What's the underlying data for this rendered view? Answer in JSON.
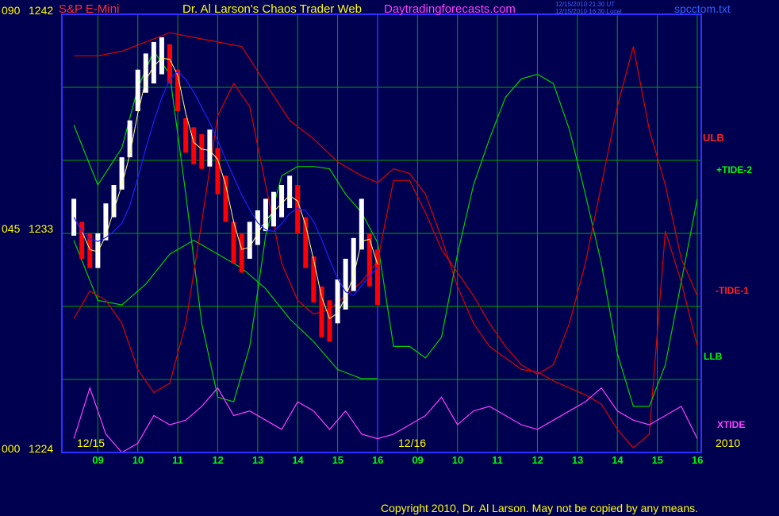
{
  "header": {
    "instrument": "S&P E-Mini",
    "title": "Dr. Al Larson's Chaos Trader Web",
    "site": "Daytradingforecasts.com",
    "stamp_ut": "12/15/2010 21:30 UT",
    "stamp_local": "12/15/2010 16:30 Local",
    "filename": "spcctom.txt"
  },
  "y_axis": {
    "top": {
      "pct": "090",
      "price": "1242"
    },
    "mid": {
      "pct": "045",
      "price": "1233"
    },
    "bottom": {
      "pct": "000",
      "price": "1224"
    }
  },
  "dates": {
    "day1": "12/15",
    "day2": "12/16",
    "year": "2010"
  },
  "hours": [
    "09",
    "10",
    "11",
    "12",
    "13",
    "14",
    "15",
    "16",
    "09",
    "10",
    "11",
    "12",
    "13",
    "14",
    "15",
    "16"
  ],
  "legend": {
    "ulb": "ULB",
    "tide2": "+TIDE-2",
    "tide1": "-TIDE-1",
    "llb": "LLB",
    "xtide": "XTIDE"
  },
  "copyright": "Copyright 2010, Dr. Al Larson. May not be copied by any means.",
  "colors": {
    "background": "#000050",
    "grid": "#00a000",
    "frame": "#3030ff",
    "price_up": "#ffffff",
    "price_down": "#ff0000",
    "ma_fast": "#ffff80",
    "ma_slow": "#2020ff",
    "tide_red": "#e00000",
    "tide_green": "#00d000",
    "xtide": "#ff40ff",
    "label_yellow": "#ffff00",
    "label_green": "#00ff00",
    "label_red": "#ff3030"
  },
  "chart_data": {
    "type": "line",
    "xlabel": "",
    "ylabel": "",
    "ylim": [
      1224,
      1243
    ],
    "x_ticks": [
      "09",
      "10",
      "11",
      "12",
      "13",
      "14",
      "15",
      "16",
      "09",
      "10",
      "11",
      "12",
      "13",
      "14",
      "15",
      "16"
    ],
    "y_ticks": [
      1224,
      1233,
      1242
    ],
    "grid": true,
    "price_bars": {
      "hours": [
        8.4,
        8.6,
        8.8,
        9.0,
        9.2,
        9.4,
        9.6,
        9.8,
        10.0,
        10.2,
        10.4,
        10.6,
        10.8,
        11.0,
        11.2,
        11.4,
        11.6,
        11.8,
        12.0,
        12.2,
        12.4,
        12.6,
        12.8,
        13.0,
        13.2,
        13.4,
        13.6,
        13.8,
        14.0,
        14.2,
        14.4,
        14.6,
        14.8,
        15.0,
        15.2,
        15.4,
        15.6,
        15.8,
        16.0
      ],
      "close": [
        1234.2,
        1233.0,
        1232.6,
        1232.8,
        1234.0,
        1235.0,
        1236.2,
        1237.6,
        1239.8,
        1240.5,
        1241.0,
        1241.2,
        1240.9,
        1239.8,
        1237.6,
        1237.3,
        1237.0,
        1237.2,
        1236.2,
        1235.0,
        1233.0,
        1232.6,
        1233.2,
        1233.8,
        1234.3,
        1234.6,
        1235.0,
        1235.3,
        1234.5,
        1233.2,
        1231.5,
        1230.0,
        1229.6,
        1230.5,
        1231.0,
        1232.3,
        1234.0,
        1232.5,
        1231.8
      ],
      "high": [
        1235.0,
        1234.0,
        1233.5,
        1233.5,
        1234.8,
        1235.6,
        1236.8,
        1238.4,
        1240.6,
        1241.3,
        1241.8,
        1242.0,
        1241.7,
        1240.6,
        1238.5,
        1238.1,
        1237.8,
        1238.0,
        1237.2,
        1236.0,
        1234.0,
        1233.5,
        1234.0,
        1234.5,
        1235.0,
        1235.3,
        1235.6,
        1236.0,
        1235.6,
        1234.2,
        1232.5,
        1231.2,
        1230.6,
        1231.5,
        1232.4,
        1233.3,
        1235.0,
        1233.5,
        1232.8
      ],
      "low": [
        1233.4,
        1232.4,
        1232.0,
        1232.0,
        1233.2,
        1234.2,
        1235.4,
        1236.8,
        1238.8,
        1239.6,
        1240.0,
        1240.4,
        1240.0,
        1238.8,
        1237.0,
        1236.5,
        1236.3,
        1236.4,
        1235.2,
        1234.0,
        1232.2,
        1231.8,
        1232.4,
        1233.0,
        1233.6,
        1233.8,
        1234.2,
        1234.6,
        1233.5,
        1232.0,
        1230.5,
        1229.0,
        1228.8,
        1229.6,
        1230.2,
        1231.0,
        1232.8,
        1231.2,
        1230.4
      ]
    },
    "series": [
      {
        "name": "ULB",
        "x": [
          8.4,
          9.0,
          9.6,
          10.2,
          10.8,
          11.4,
          12.0,
          12.6,
          13.2,
          13.8,
          14.4,
          15.0,
          15.6,
          16.0,
          16.4,
          16.8,
          17.2,
          17.6,
          18.0,
          18.4,
          18.8,
          19.2,
          19.6,
          20.0,
          20.4,
          20.8,
          21.2,
          21.6,
          22.0,
          22.4,
          22.8,
          23.2,
          23.6,
          24.0
        ],
        "y": [
          1241.2,
          1241.2,
          1241.4,
          1241.8,
          1242.2,
          1242.0,
          1241.8,
          1241.6,
          1240.0,
          1238.4,
          1237.6,
          1236.6,
          1236.0,
          1235.7,
          1236.3,
          1236.1,
          1235.2,
          1233.3,
          1231.2,
          1229.6,
          1228.6,
          1228.1,
          1227.6,
          1227.5,
          1227.1,
          1226.8,
          1226.5,
          1226.1,
          1225.0,
          1224.2,
          1224.8,
          1233.6,
          1231.4,
          1228.6
        ]
      },
      {
        "name": "LLB",
        "x": [
          8.4,
          9.0,
          9.6,
          10.2,
          10.8,
          11.4,
          12.0,
          12.6,
          13.2,
          13.8,
          14.4,
          15.0,
          15.6,
          16.0
        ],
        "y": [
          1233.2,
          1230.6,
          1230.4,
          1231.3,
          1232.6,
          1233.2,
          1232.6,
          1232.0,
          1231.1,
          1229.8,
          1228.8,
          1227.6,
          1227.2,
          1227.2
        ]
      },
      {
        "name": "+TIDE-2",
        "x": [
          8.4,
          9.0,
          9.6,
          10.0,
          10.4,
          10.8,
          11.2,
          11.6,
          12.0,
          12.4,
          12.8,
          13.2,
          13.6,
          14.0,
          14.4,
          14.8,
          15.2,
          15.6,
          16.0,
          16.4,
          16.8,
          17.2,
          17.6,
          18.0,
          18.4,
          18.8,
          19.2,
          19.6,
          20.0,
          20.4,
          20.8,
          21.2,
          21.6,
          22.0,
          22.4,
          22.8,
          23.2,
          23.6,
          24.0
        ],
        "y": [
          1238.2,
          1235.6,
          1237.2,
          1239.8,
          1241.4,
          1240.4,
          1235.2,
          1229.6,
          1226.4,
          1226.2,
          1228.6,
          1233.4,
          1236.0,
          1236.4,
          1236.4,
          1236.3,
          1235.2,
          1234.4,
          1233.1,
          1228.6,
          1228.6,
          1228.1,
          1229.0,
          1232.6,
          1235.6,
          1237.6,
          1239.4,
          1240.2,
          1240.4,
          1240.0,
          1238.0,
          1235.2,
          1232.2,
          1228.3,
          1226.0,
          1226.0,
          1227.8,
          1231.4,
          1235.0
        ]
      },
      {
        "name": "-TIDE-1",
        "x": [
          8.4,
          8.8,
          9.2,
          9.6,
          10.0,
          10.4,
          10.8,
          11.2,
          11.6,
          12.0,
          12.4,
          12.8,
          13.2,
          13.6,
          14.0,
          14.4,
          14.8,
          15.2,
          15.6,
          16.0,
          16.4,
          16.8,
          17.2,
          17.6,
          18.0,
          18.4,
          18.8,
          19.2,
          19.6,
          20.0,
          20.4,
          20.8,
          21.2,
          21.6,
          22.0,
          22.4,
          22.8,
          23.2,
          23.6,
          24.0
        ],
        "y": [
          1229.8,
          1231.0,
          1230.6,
          1229.6,
          1227.6,
          1226.6,
          1227.0,
          1229.6,
          1234.0,
          1238.6,
          1240.0,
          1239.0,
          1235.6,
          1232.2,
          1230.6,
          1230.0,
          1230.2,
          1230.8,
          1231.4,
          1232.3,
          1235.8,
          1235.8,
          1234.4,
          1232.8,
          1231.8,
          1230.8,
          1229.6,
          1228.6,
          1227.8,
          1227.4,
          1227.8,
          1229.6,
          1232.2,
          1235.6,
          1239.0,
          1241.6,
          1238.0,
          1235.6,
          1232.4,
          1230.8
        ]
      },
      {
        "name": "XTIDE",
        "x": [
          8.4,
          8.8,
          9.2,
          9.6,
          10.0,
          10.4,
          10.8,
          11.2,
          11.6,
          12.0,
          12.4,
          12.8,
          13.2,
          13.6,
          14.0,
          14.4,
          14.8,
          15.2,
          15.6,
          16.0,
          16.4,
          16.8,
          17.2,
          17.6,
          18.0,
          18.4,
          18.8,
          19.2,
          19.6,
          20.0,
          20.4,
          20.8,
          21.2,
          21.6,
          22.0,
          22.4,
          22.8,
          23.2,
          23.6,
          24.0
        ],
        "y": [
          1224.6,
          1226.8,
          1224.8,
          1224.0,
          1224.4,
          1225.6,
          1225.2,
          1225.4,
          1226.0,
          1226.8,
          1225.6,
          1225.8,
          1225.4,
          1225.0,
          1226.2,
          1225.8,
          1225.0,
          1225.8,
          1224.8,
          1224.6,
          1224.8,
          1225.2,
          1225.6,
          1226.4,
          1225.2,
          1225.8,
          1226.0,
          1225.6,
          1225.2,
          1225.0,
          1225.4,
          1225.8,
          1226.2,
          1226.8,
          1225.8,
          1225.4,
          1225.2,
          1225.6,
          1226.0,
          1224.6
        ]
      }
    ]
  }
}
